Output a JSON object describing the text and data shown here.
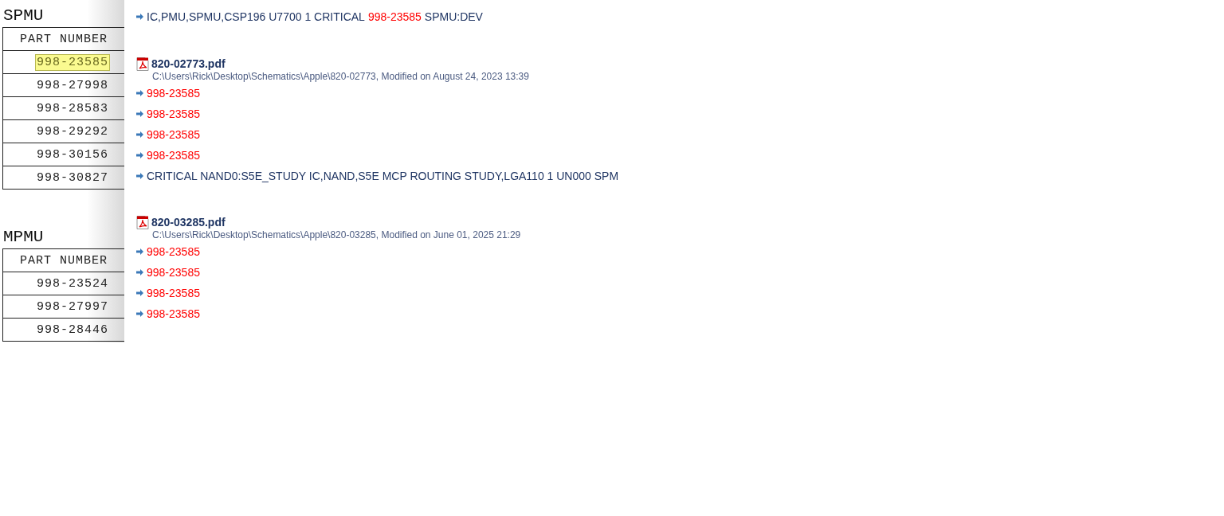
{
  "sidebar": {
    "sections": [
      {
        "title": "SPMU",
        "header": "PART NUMBER",
        "rows": [
          {
            "value": "998-23585",
            "highlighted": true
          },
          {
            "value": "998-27998",
            "highlighted": false
          },
          {
            "value": "998-28583",
            "highlighted": false
          },
          {
            "value": "998-29292",
            "highlighted": false
          },
          {
            "value": "998-30156",
            "highlighted": false
          },
          {
            "value": "998-30827",
            "highlighted": false
          }
        ]
      },
      {
        "title": "MPMU",
        "header": "PART NUMBER",
        "rows": [
          {
            "value": "998-23524",
            "highlighted": false
          },
          {
            "value": "998-27997",
            "highlighted": false
          },
          {
            "value": "998-28446",
            "highlighted": false
          }
        ]
      }
    ]
  },
  "results": [
    {
      "kind": "hits",
      "hits": [
        {
          "segments": [
            {
              "text": "IC,PMU,SPMU,CSP196 U7700 1 CRITICAL",
              "match": false
            },
            {
              "text": "998-23585",
              "match": true
            },
            {
              "text": "SPMU:DEV",
              "match": false
            }
          ]
        }
      ]
    },
    {
      "kind": "file",
      "name": "820-02773.pdf",
      "path": "C:\\Users\\Rick\\Desktop\\Schematics\\Apple\\820-02773, Modified on August 24, 2023 13:39",
      "hits": [
        {
          "segments": [
            {
              "text": "998-23585",
              "match": true
            }
          ]
        },
        {
          "segments": [
            {
              "text": "998-23585",
              "match": true
            }
          ]
        },
        {
          "segments": [
            {
              "text": "998-23585",
              "match": true
            }
          ]
        },
        {
          "segments": [
            {
              "text": "998-23585",
              "match": true
            }
          ]
        },
        {
          "segments": [
            {
              "text": "CRITICAL NAND0:S5E_STUDY IC,NAND,S5E MCP ROUTING STUDY,LGA110 1 UN000 SPM",
              "match": false
            }
          ]
        }
      ]
    },
    {
      "kind": "file",
      "name": "820-03285.pdf",
      "path": "C:\\Users\\Rick\\Desktop\\Schematics\\Apple\\820-03285, Modified on June 01, 2025 21:29",
      "hits": [
        {
          "segments": [
            {
              "text": "998-23585",
              "match": true
            }
          ]
        },
        {
          "segments": [
            {
              "text": "998-23585",
              "match": true
            }
          ]
        },
        {
          "segments": [
            {
              "text": "998-23585",
              "match": true
            }
          ]
        },
        {
          "segments": [
            {
              "text": "998-23585",
              "match": true
            }
          ]
        }
      ]
    }
  ]
}
